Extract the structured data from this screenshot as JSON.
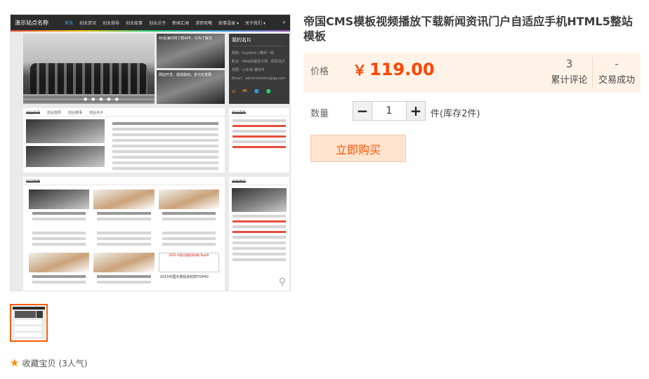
{
  "product": {
    "title": "帝国CMS模板视频播放下载新闻资讯门户自适应手机HTML5整站模板"
  },
  "price": {
    "label": "价格",
    "currency": "￥",
    "amount": "119.00",
    "reviews_count": "3",
    "reviews_label": "累计评论",
    "trades_count": "-",
    "trades_label": "交易成功"
  },
  "quantity": {
    "label": "数量",
    "value": "1",
    "minus": "−",
    "plus": "+",
    "stock_text": "件(库存2件)"
  },
  "buy_button": "立即购买",
  "favorite": {
    "text": "收藏宝贝",
    "count_text": "(3人气)"
  },
  "preview": {
    "site_name": "演示站点名称",
    "nav": [
      "首页",
      "创业资讯",
      "创业指导",
      "创业故事",
      "创业点子",
      "新闻汇闻",
      "求职攻略",
      "故事语录 ▾",
      "关于我们 ▾"
    ],
    "card_title": "我的名片",
    "card_lines": [
      "网名：kuyibird | 腾讯一佰",
      "职业：Web前端设计师、网页设计",
      "现居：山东省-潍坊市",
      "Email：administrator@qq.com"
    ],
    "banner_caption_1": "80后海归将了款APP，只为了解决",
    "banner_caption_2": "网站开发，提低能动，多元化发展",
    "tabs": [
      "创业资讯",
      "创业指导",
      "创业故事",
      "创业点子"
    ],
    "recent_title": "最近更新",
    "featured_title": "特别推荐",
    "hot_title": "点击排行",
    "table_title": "2015 中国天使投资机构 Top40",
    "cover_caption": "2015中国天使投资机构TOP40"
  },
  "colors": {
    "accent": "#ff4400",
    "buy_text": "#ff5500",
    "price_bg": "#fff3e8",
    "thumb_border": "#ff5a00",
    "star": "#ff8a00"
  }
}
